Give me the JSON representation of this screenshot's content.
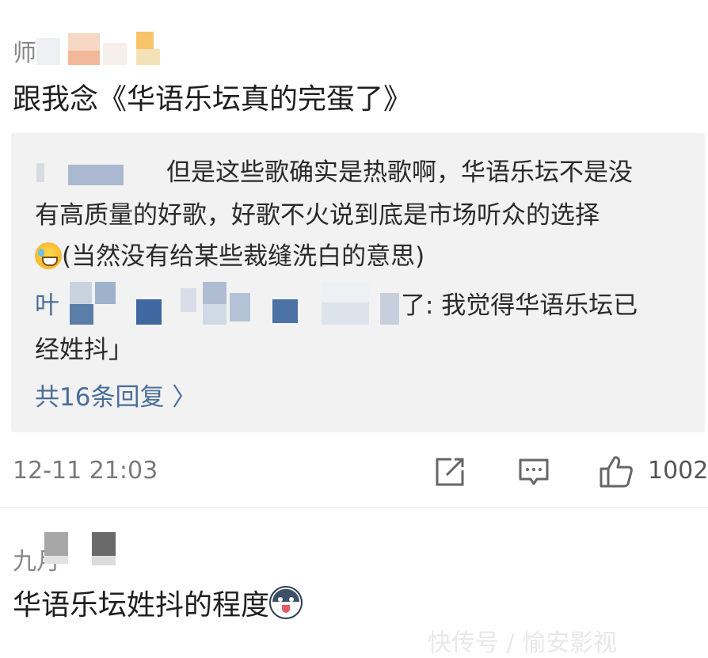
{
  "comment1": {
    "username": "师",
    "text": "跟我念《华语乐坛真的完蛋了》",
    "replies": {
      "reply1_line1": "但是这些歌确实是热歌啊，华语乐坛不是没",
      "reply1_line2": "有高质量的好歌，好歌不火说到底是市场听众的选择",
      "reply1_line3": "(当然没有给某些裁缝洗白的意思)",
      "reply2_user_prefix": "叶",
      "reply2_text": "了: 我觉得华语乐坛已",
      "reply2_line2": "经姓抖」",
      "more_label": "共16条回复 〉"
    },
    "timestamp": "12-11 21:03",
    "like_count": "1002"
  },
  "comment2": {
    "username": "九月",
    "text": "华语乐坛姓抖的程度"
  },
  "watermark": "快传号 / 愉安影视",
  "colors": {
    "link_blue": "#4a6e9a",
    "reply_bg": "#f2f2f2",
    "text": "#1f1f1f",
    "meta_gray": "#7a7a7a"
  },
  "icons": [
    "share-icon",
    "comment-icon",
    "like-icon",
    "grin-sweat-emoji",
    "husky-emoji"
  ]
}
